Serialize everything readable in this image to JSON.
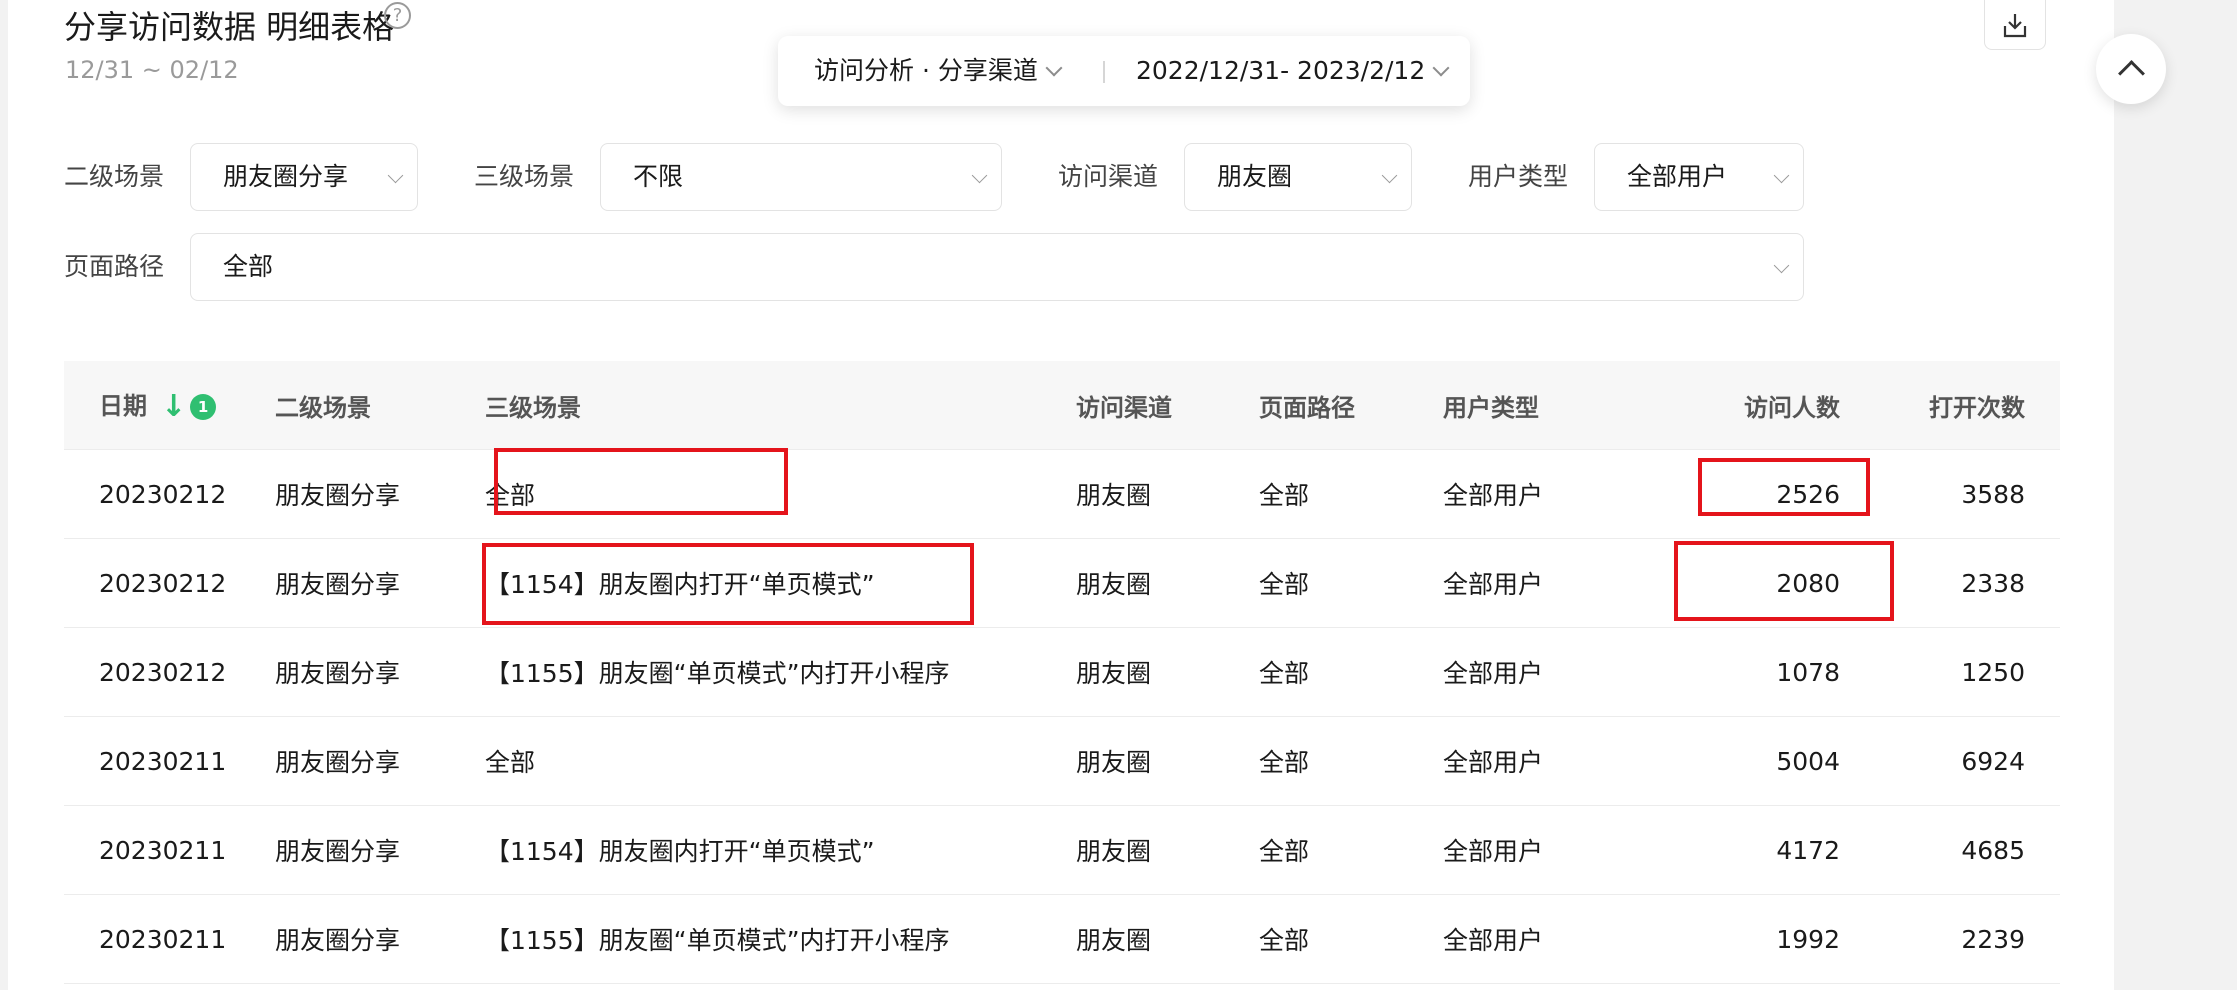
{
  "header": {
    "title": "分享访问数据 明细表格",
    "help_icon": "?",
    "date_range": "12/31 ~ 02/12"
  },
  "float_bar": {
    "analysis": "访问分析 · 分享渠道",
    "date": "2022/12/31- 2023/2/12"
  },
  "filters": {
    "scene2_label": "二级场景",
    "scene2_value": "朋友圈分享",
    "scene3_label": "三级场景",
    "scene3_value": "不限",
    "channel_label": "访问渠道",
    "channel_value": "朋友圈",
    "usertype_label": "用户类型",
    "usertype_value": "全部用户",
    "path_label": "页面路径",
    "path_value": "全部"
  },
  "table": {
    "columns": [
      "日期",
      "二级场景",
      "三级场景",
      "访问渠道",
      "页面路径",
      "用户类型",
      "访问人数",
      "打开次数"
    ],
    "sort_badge": "1",
    "rows": [
      [
        "20230212",
        "朋友圈分享",
        "全部",
        "朋友圈",
        "全部",
        "全部用户",
        "2526",
        "3588"
      ],
      [
        "20230212",
        "朋友圈分享",
        "【1154】朋友圈内打开“单页模式”",
        "朋友圈",
        "全部",
        "全部用户",
        "2080",
        "2338"
      ],
      [
        "20230212",
        "朋友圈分享",
        "【1155】朋友圈“单页模式”内打开小程序",
        "朋友圈",
        "全部",
        "全部用户",
        "1078",
        "1250"
      ],
      [
        "20230211",
        "朋友圈分享",
        "全部",
        "朋友圈",
        "全部",
        "全部用户",
        "5004",
        "6924"
      ],
      [
        "20230211",
        "朋友圈分享",
        "【1154】朋友圈内打开“单页模式”",
        "朋友圈",
        "全部",
        "全部用户",
        "4172",
        "4685"
      ],
      [
        "20230211",
        "朋友圈分享",
        "【1155】朋友圈“单页模式”内打开小程序",
        "朋友圈",
        "全部",
        "全部用户",
        "1992",
        "2239"
      ]
    ]
  },
  "colors": {
    "accent": "#2fbf71",
    "highlight": "#e4141b",
    "header_bg": "#f7f7f7"
  }
}
